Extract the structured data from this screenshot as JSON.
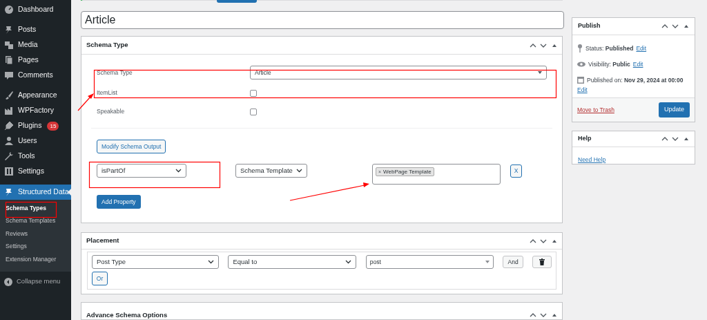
{
  "sidebar": {
    "groups": [
      [
        {
          "label": "Dashboard"
        }
      ],
      [
        {
          "label": "Posts"
        },
        {
          "label": "Media"
        },
        {
          "label": "Pages"
        },
        {
          "label": "Comments"
        }
      ],
      [
        {
          "label": "Appearance"
        },
        {
          "label": "WPFactory"
        },
        {
          "label": "Plugins",
          "badge": "15"
        },
        {
          "label": "Users"
        },
        {
          "label": "Tools"
        },
        {
          "label": "Settings"
        }
      ]
    ],
    "current": {
      "label": "Structured Data",
      "selected": true,
      "submenu": [
        {
          "label": "Schema Types",
          "selected": true
        },
        {
          "label": "Schema Templates",
          "selected": false
        },
        {
          "label": "Reviews",
          "selected": false
        },
        {
          "label": "Settings",
          "selected": false
        },
        {
          "label": "Extension Manager",
          "selected": false
        }
      ]
    },
    "collapse": "Collapse menu"
  },
  "title_field": {
    "value": "Article"
  },
  "schema_type_panel": {
    "title": "Schema Type",
    "fields": [
      {
        "kind": "select",
        "label": "Schema Type",
        "value": "Article"
      },
      {
        "kind": "checkbox",
        "label": "ItemList",
        "checked": false
      },
      {
        "kind": "checkbox",
        "label": "Speakable",
        "checked": false
      }
    ],
    "modify_button": "Modify Schema Output",
    "property": {
      "name": "isPartOf",
      "type": "Schema Template",
      "values": [
        {
          "label": "WebPage Template",
          "remove": "×"
        }
      ],
      "remove_button": "X"
    },
    "add_button": "Add Property"
  },
  "placement_panel": {
    "title": "Placement",
    "rule": {
      "field": "Post Type",
      "operator": "Equal to",
      "value": "post",
      "and_button": "And"
    },
    "or_button": "Or"
  },
  "advanced_panel": {
    "title": "Advance Schema Options"
  },
  "publish_box": {
    "title": "Publish",
    "status_label": "Status:",
    "status": "Published",
    "visibility_label": "Visibility:",
    "visibility": "Public",
    "date_label": "Published on:",
    "date": "Nov 29, 2024 at 00:00",
    "status_edit": "Edit",
    "visibility_edit": "Edit",
    "date_edit": "Edit",
    "trash": "Move to Trash",
    "update": "Update"
  },
  "help_box": {
    "title": "Help",
    "link": "Need Help"
  }
}
